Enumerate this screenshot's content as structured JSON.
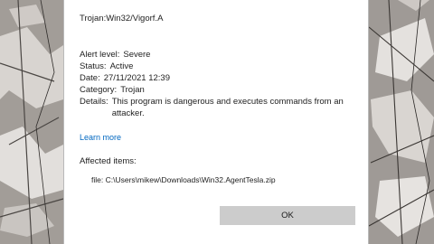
{
  "dialog": {
    "title": "Trojan:Win32/Vigorf.A",
    "details": {
      "alert_level_label": "Alert level:",
      "alert_level_value": "Severe",
      "status_label": "Status:",
      "status_value": "Active",
      "date_label": "Date:",
      "date_value": "27/11/2021 12:39",
      "category_label": "Category:",
      "category_value": "Trojan",
      "details_label": "Details:",
      "details_value": "This program is dangerous and executes commands from an attacker."
    },
    "learn_more_label": "Learn more",
    "affected_items_label": "Affected items:",
    "affected_item": "file: C:\\Users\\mikew\\Downloads\\Win32.AgentTesla.zip",
    "ok_label": "OK"
  },
  "colors": {
    "link": "#0067c0",
    "button_bg": "#cccccc",
    "dialog_bg": "#ffffff"
  }
}
